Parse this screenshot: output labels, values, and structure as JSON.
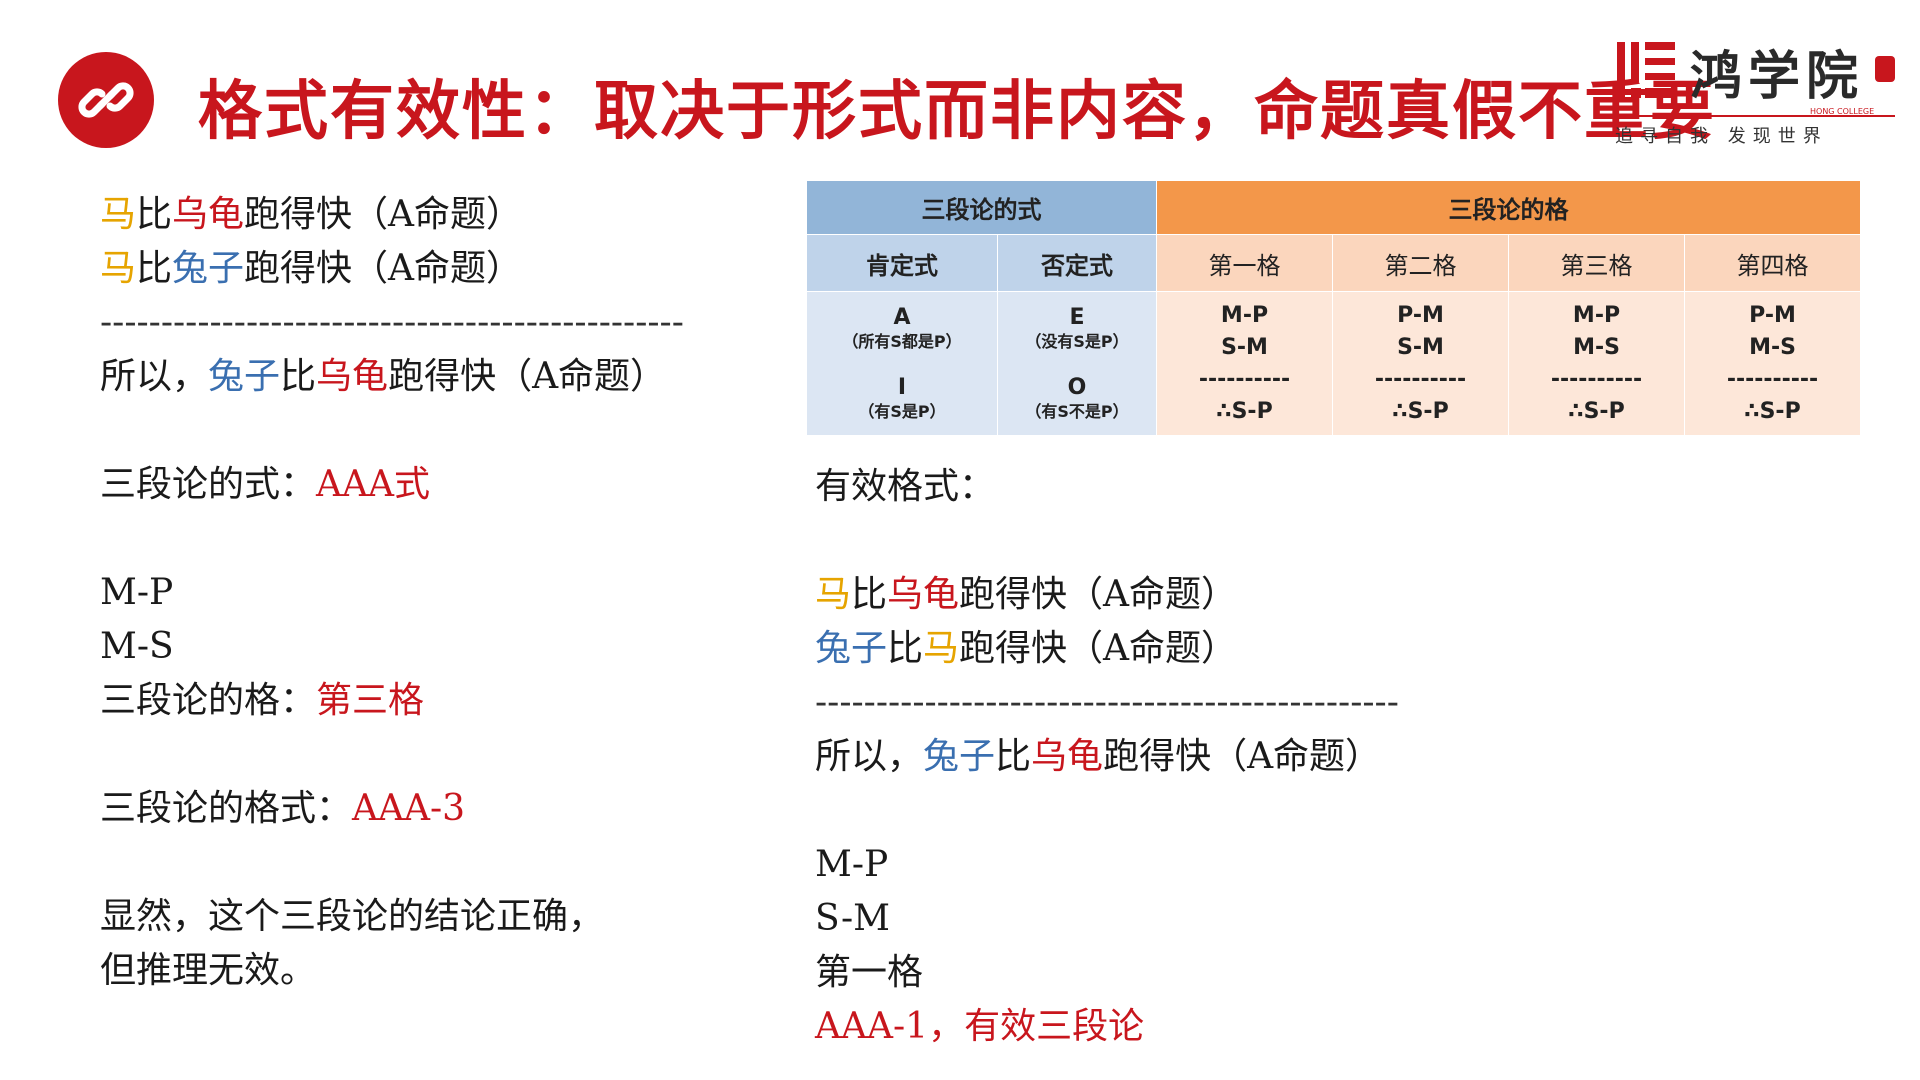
{
  "header": {
    "title": "格式有效性：取决于形式而非内容，命题真假不重要",
    "icon": "link-icon",
    "accent_color": "#c8161d"
  },
  "logo": {
    "name": "鸿学院",
    "english": "HONG COLLEGE",
    "slogan": "追寻自我  发现世界"
  },
  "colors": {
    "yellow": "#e6a400",
    "red": "#c8161d",
    "blue": "#3a6fb0"
  },
  "left": {
    "p1": {
      "a": "马",
      "b": "比",
      "c": "乌龟",
      "d": "跑得快（A命题）"
    },
    "p2": {
      "a": "马",
      "b": "比",
      "c": "兔子",
      "d": "跑得快（A命题）"
    },
    "divider": "------------------------------------------------",
    "conclusion": {
      "a": "所以，",
      "b": "兔子",
      "c": "比",
      "d": "乌龟",
      "e": "跑得快（A命题）"
    },
    "mood_label": "三段论的式：",
    "mood_value": "AAA式",
    "fig_line1": "M-P",
    "fig_line2": "M-S",
    "figure_label": "三段论的格：",
    "figure_value": "第三格",
    "form_label": "三段论的格式：",
    "form_value": "AAA-3",
    "note_line1": "显然，这个三段论的结论正确，",
    "note_line2": "但推理无效。"
  },
  "table": {
    "mood_header": "三段论的式",
    "figure_header": "三段论的格",
    "affirmative": "肯定式",
    "negative": "否定式",
    "figures": [
      "第一格",
      "第二格",
      "第三格",
      "第四格"
    ],
    "moods": {
      "A": "A",
      "A_desc": "（所有S都是P）",
      "E": "E",
      "E_desc": "（没有S是P）",
      "I": "I",
      "I_desc": "（有S是P）",
      "O": "O",
      "O_desc": "（有S不是P）"
    },
    "figure_forms": [
      {
        "major": "M-P",
        "minor": "S-M",
        "line": "----------",
        "concl": "∴S-P"
      },
      {
        "major": "P-M",
        "minor": "S-M",
        "line": "----------",
        "concl": "∴S-P"
      },
      {
        "major": "M-P",
        "minor": "M-S",
        "line": "----------",
        "concl": "∴S-P"
      },
      {
        "major": "P-M",
        "minor": "M-S",
        "line": "----------",
        "concl": "∴S-P"
      }
    ]
  },
  "right": {
    "valid_label": "有效格式：",
    "p1": {
      "a": "马",
      "b": "比",
      "c": "乌龟",
      "d": "跑得快（A命题）"
    },
    "p2": {
      "a": "兔子",
      "b": "比",
      "c": "马",
      "d": "跑得快（A命题）"
    },
    "divider": "------------------------------------------------",
    "conclusion": {
      "a": "所以，",
      "b": "兔子",
      "c": "比",
      "d": "乌龟",
      "e": "跑得快（A命题）"
    },
    "fig_line1": "M-P",
    "fig_line2": "S-M",
    "figure": "第一格",
    "result": "AAA-1，有效三段论"
  }
}
